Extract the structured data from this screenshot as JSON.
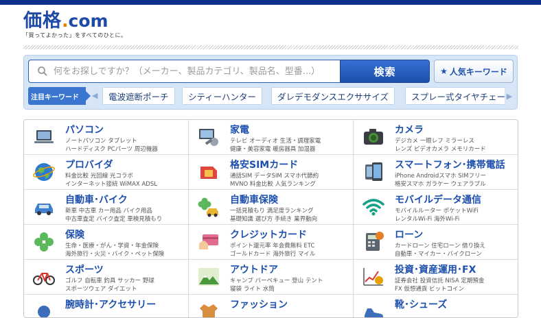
{
  "header": {
    "logo_main": "価格",
    "logo_dot": ".",
    "logo_com": "com",
    "tagline": "「買ってよかった」をすべてのひとに。"
  },
  "search": {
    "placeholder": "何をお探しですか？（メーカー、製品カテゴリ、製品名、型番...）",
    "button_label": "検索",
    "popular_label": "人気キーワード"
  },
  "keywords": {
    "label": "注目キーワード",
    "items": [
      "電波遮断ポーチ",
      "シティーハンター",
      "ダレデモダンスエクササイズ",
      "スプレー式タイヤチェーン"
    ]
  },
  "categories": [
    {
      "title": "パソコン",
      "sub1": "ノートパソコン  タブレット",
      "sub2": "ハードディスク  PCパーツ  周辺機器",
      "icon": "laptop-icon"
    },
    {
      "title": "家電",
      "sub1": "テレビ  オーディオ  生活・調理家電",
      "sub2": "健康・美容家電  暖房器具  加湿器",
      "icon": "tv-tools-icon"
    },
    {
      "title": "カメラ",
      "sub1": "デジカメ  一眼レフ  ミラーレス",
      "sub2": "レンズ  ビデオカメラ  メモリカード",
      "icon": "camera-icon"
    },
    {
      "title": "プロバイダ",
      "sub1": "料金比較  光回線  光コラボ",
      "sub2": "インターネット接続  WiMAX  ADSL",
      "icon": "globe-icon"
    },
    {
      "title": "格安SIMカード",
      "sub1": "通話SIM  データSIM  スマホ代節約",
      "sub2": "MVNO  料金比較  人気ランキング",
      "icon": "sim-card-icon"
    },
    {
      "title": "スマートフォン･携帯電話",
      "sub1": "iPhone  Androidスマホ  SIMフリー",
      "sub2": "格安スマホ  ガラケー  ウェアラブル",
      "icon": "smartphone-icon"
    },
    {
      "title": "自動車･バイク",
      "sub1": "新車  中古車  カー用品  バイク用品",
      "sub2": "中古車査定  バイク査定  車検見積もり",
      "icon": "car-icon"
    },
    {
      "title": "自動車保険",
      "sub1": "一括見積もり  満足度ランキング",
      "sub2": "基礎知識  選び方  手続き  業界動向",
      "icon": "clover-car-icon"
    },
    {
      "title": "モバイルデータ通信",
      "sub1": "モバイルルーター  ポケットWiFi",
      "sub2": "レンタルWi-Fi  海外Wi-Fi",
      "icon": "wifi-icon"
    },
    {
      "title": "保険",
      "sub1": "生命・医療・がん・学資・年金保険",
      "sub2": "海外旅行・火災・バイク・ペット保険",
      "icon": "clover-icon"
    },
    {
      "title": "クレジットカード",
      "sub1": "ポイント還元率  年会費無料  ETC",
      "sub2": "ゴールドカード  海外旅行  マイル",
      "icon": "credit-card-icon"
    },
    {
      "title": "ローン",
      "sub1": "カードローン  住宅ローン  借り換え",
      "sub2": "自動車・マイカー・バイクローン",
      "icon": "calculator-icon"
    },
    {
      "title": "スポーツ",
      "sub1": "ゴルフ  自転車  釣具  サッカー  野球",
      "sub2": "スポーツウェア  ダイエット",
      "icon": "bicycle-icon"
    },
    {
      "title": "アウトドア",
      "sub1": "キャンプ  バーベキュー  登山  テント",
      "sub2": "寝袋  ライト  水筒",
      "icon": "mountain-icon"
    },
    {
      "title": "投資･資産運用･FX",
      "sub1": "証券会社  投資信託  NISA  定期預金",
      "sub2": "FX  仮想通貨  ビットコイン",
      "icon": "chart-yen-icon"
    },
    {
      "title": "腕時計･アクセサリー",
      "sub1": "",
      "sub2": "",
      "icon": "watch-icon"
    },
    {
      "title": "ファッション",
      "sub1": "",
      "sub2": "",
      "icon": "fashion-icon"
    },
    {
      "title": "靴･シューズ",
      "sub1": "",
      "sub2": "",
      "icon": "shoe-icon"
    }
  ]
}
